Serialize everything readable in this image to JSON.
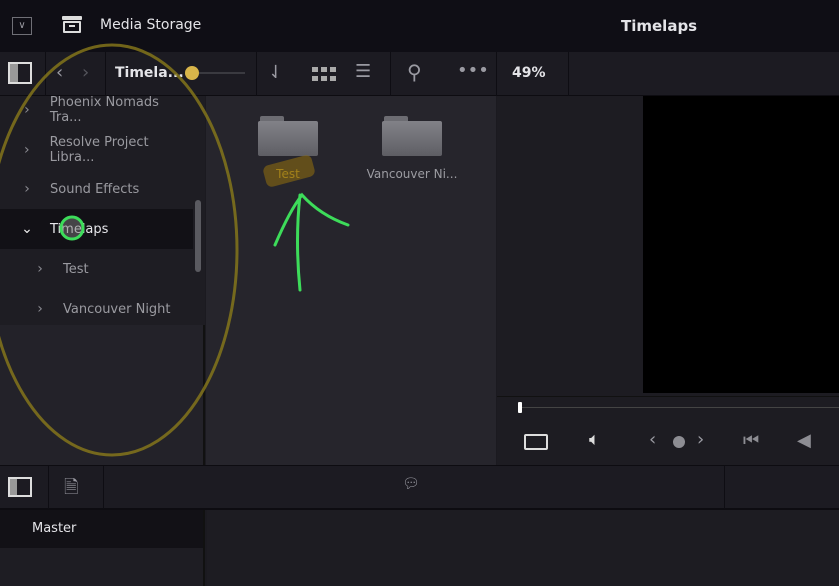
{
  "header": {
    "panel_title": "Media Storage",
    "viewer_title": "Timelaps"
  },
  "toolbar": {
    "path": "Timela...",
    "zoom": "49%"
  },
  "sidebar": {
    "items": [
      {
        "label": "Phoenix Nomads Tra...",
        "expanded": false,
        "level": 0
      },
      {
        "label": "Resolve Project Libra...",
        "expanded": false,
        "level": 0
      },
      {
        "label": "Sound Effects",
        "expanded": false,
        "level": 0
      },
      {
        "label": "Timelaps",
        "expanded": true,
        "level": 0,
        "selected": true
      },
      {
        "label": "Test",
        "expanded": false,
        "level": 1
      },
      {
        "label": "Vancouver Night",
        "expanded": false,
        "level": 1
      }
    ]
  },
  "folders": [
    {
      "label": "Test"
    },
    {
      "label": "Vancouver Ni..."
    }
  ],
  "bins": {
    "master": "Master"
  },
  "colors": {
    "annotation_yellow": "#8a7a1a",
    "annotation_green": "#3ddc5a",
    "selected_label": "#c9a227"
  }
}
